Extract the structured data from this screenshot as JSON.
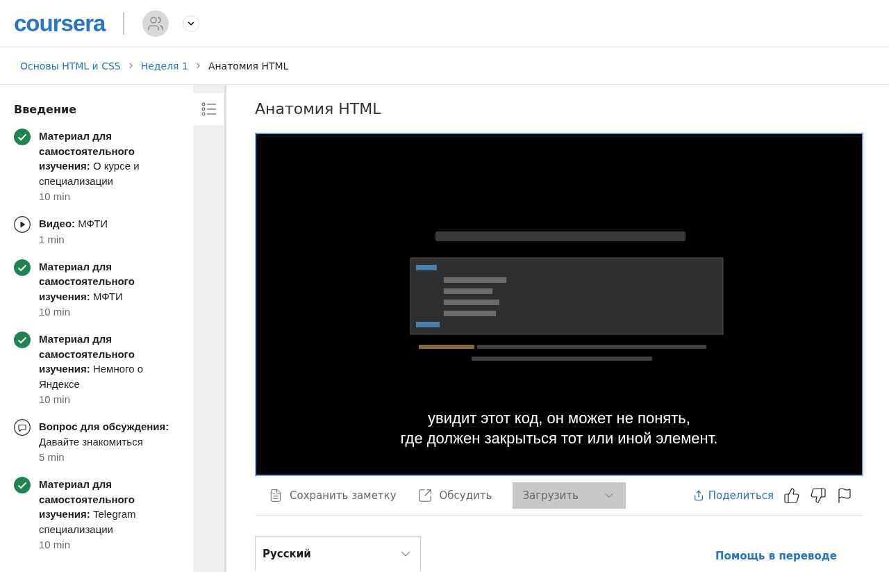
{
  "header": {
    "logo": "coursera"
  },
  "breadcrumbs": [
    {
      "label": "Основы HTML и CSS",
      "kind": "link"
    },
    {
      "label": "Неделя 1",
      "kind": "link"
    },
    {
      "label": "Анатомия HTML",
      "kind": "current"
    }
  ],
  "sidebar": {
    "title": "Введение",
    "items": [
      {
        "completed": true,
        "text": "**Материал для самостоятельного изучения:** О курсе и специализации",
        "time": "10 min"
      },
      {
        "kind": "video",
        "completed": false,
        "text": "**Видео:** МФТИ",
        "time": "1 min"
      },
      {
        "completed": true,
        "text": "**Материал для самостоятельного изучения:** МФТИ",
        "time": "10 min"
      },
      {
        "completed": true,
        "text": "**Материал для самостоятельного изучения:** Немного о Яндексе",
        "time": "10 min"
      },
      {
        "kind": "discussion",
        "completed": false,
        "text": "**Вопрос для обсуждения:** Давайте знакомиться",
        "time": "5 min"
      },
      {
        "completed": true,
        "text": "**Материал для самостоятельного изучения:** Telegram специализации",
        "time": "10 min"
      }
    ]
  },
  "lesson": {
    "title": "Анатомия HTML",
    "video": {
      "kind": "picture",
      "captions": [
        "увидит этот код, он может не понять,",
        "где должен закрыться тот или иной элемент."
      ]
    },
    "toolbar": {
      "actions": [
        {
          "kind": "note",
          "label": "Сохранить заметку"
        },
        {
          "kind": "discuss",
          "label": "Обсудить"
        },
        {
          "kind": "download",
          "label": "Загрузить"
        }
      ],
      "share": "Поделиться"
    },
    "language": {
      "value": "Русский"
    },
    "help_link": "Помощь в переводе"
  }
}
